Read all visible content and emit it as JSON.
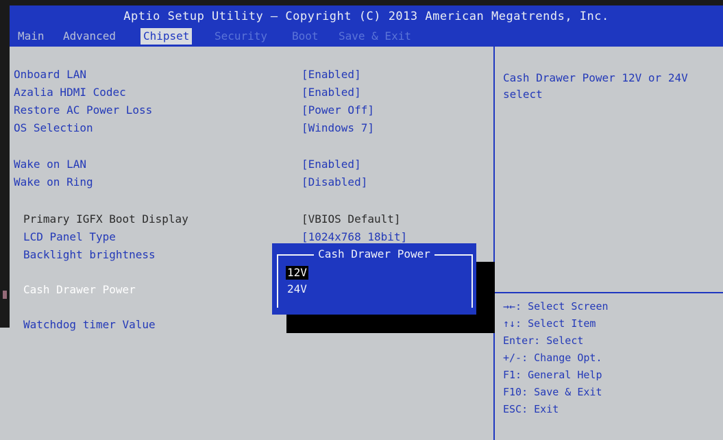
{
  "header": {
    "title": "Aptio Setup Utility – Copyright (C) 2013 American Megatrends, Inc.",
    "tabs": [
      "Main",
      "Advanced",
      "Chipset",
      "Security",
      "Boot",
      "Save & Exit"
    ],
    "active_tab": "Chipset"
  },
  "settings": [
    {
      "label": "Onboard LAN",
      "value": "[Enabled]"
    },
    {
      "label": "Azalia HDMI Codec",
      "value": "[Enabled]"
    },
    {
      "label": "Restore AC Power Loss",
      "value": "[Power Off]"
    },
    {
      "label": "OS Selection",
      "value": "[Windows 7]"
    },
    {
      "label": "Wake on LAN",
      "value": "[Enabled]"
    },
    {
      "label": "Wake on Ring",
      "value": "[Disabled]"
    },
    {
      "label": "Primary IGFX Boot Display",
      "value": "[VBIOS Default]"
    },
    {
      "label": "LCD Panel Type",
      "value": "[1024x768  18bit]"
    },
    {
      "label": "Backlight brightness",
      "value": ""
    },
    {
      "label": "Cash Drawer Power",
      "value": ""
    },
    {
      "label": "Watchdog timer Value",
      "value": ""
    }
  ],
  "help": {
    "description": "Cash Drawer Power 12V or 24V select",
    "keys": [
      "→←: Select Screen",
      "↑↓: Select Item",
      "Enter: Select",
      "+/-: Change Opt.",
      "F1: General Help",
      "F10: Save & Exit",
      "ESC: Exit"
    ]
  },
  "popup": {
    "title": "Cash Drawer Power",
    "options": [
      "12V",
      "24V"
    ],
    "selected": "12V"
  },
  "colors": {
    "header_blue": "#1e37c0",
    "panel_gray": "#c6c9cc",
    "link_blue": "#2339b8"
  }
}
